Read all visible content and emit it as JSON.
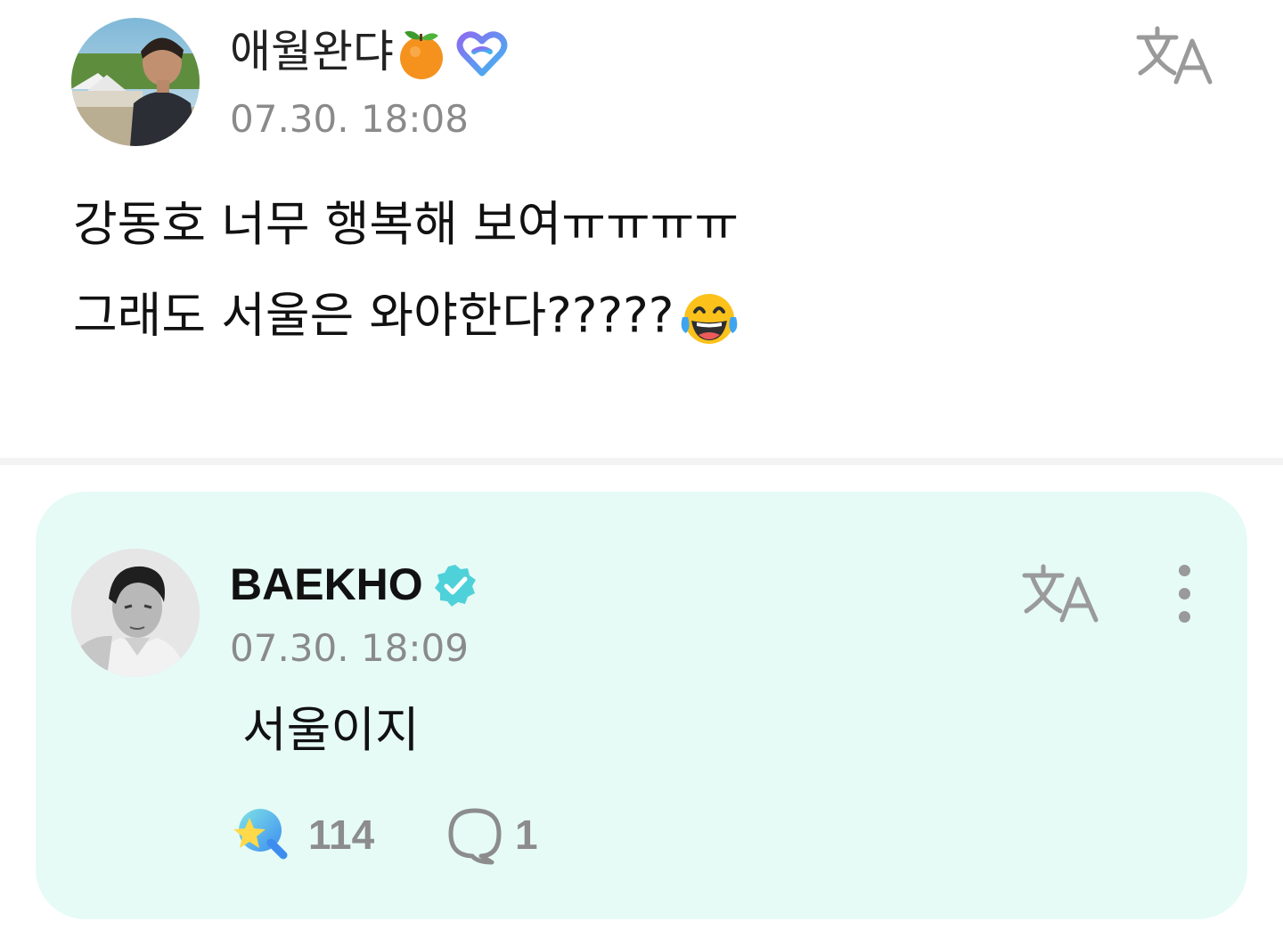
{
  "post": {
    "author_name": "애월완댜",
    "author_badges": [
      "tangerine-emoji",
      "membership-heart-icon"
    ],
    "timestamp": "07.30. 18:08",
    "body_lines": [
      "강동호 너무 행복해 보여ㅠㅠㅠㅠ",
      "그래도 서울은 와야한다?????"
    ],
    "body_trailing_emoji": "laughing-tears-emoji"
  },
  "reply": {
    "author_name": "BAEKHO",
    "verified": true,
    "timestamp": "07.30. 18:09",
    "text": "서울이지",
    "like_count": "114",
    "comment_count": "1"
  },
  "colors": {
    "reply_background": "#e6fbf6",
    "verified_badge": "#4fd1d9",
    "timestamp_gray": "#8a8a8a",
    "icon_gray": "#9a9a9a"
  },
  "icons": [
    "translate-icon",
    "more-vertical-icon",
    "like-wand-icon",
    "comment-bubble-icon",
    "verified-badge-icon"
  ]
}
